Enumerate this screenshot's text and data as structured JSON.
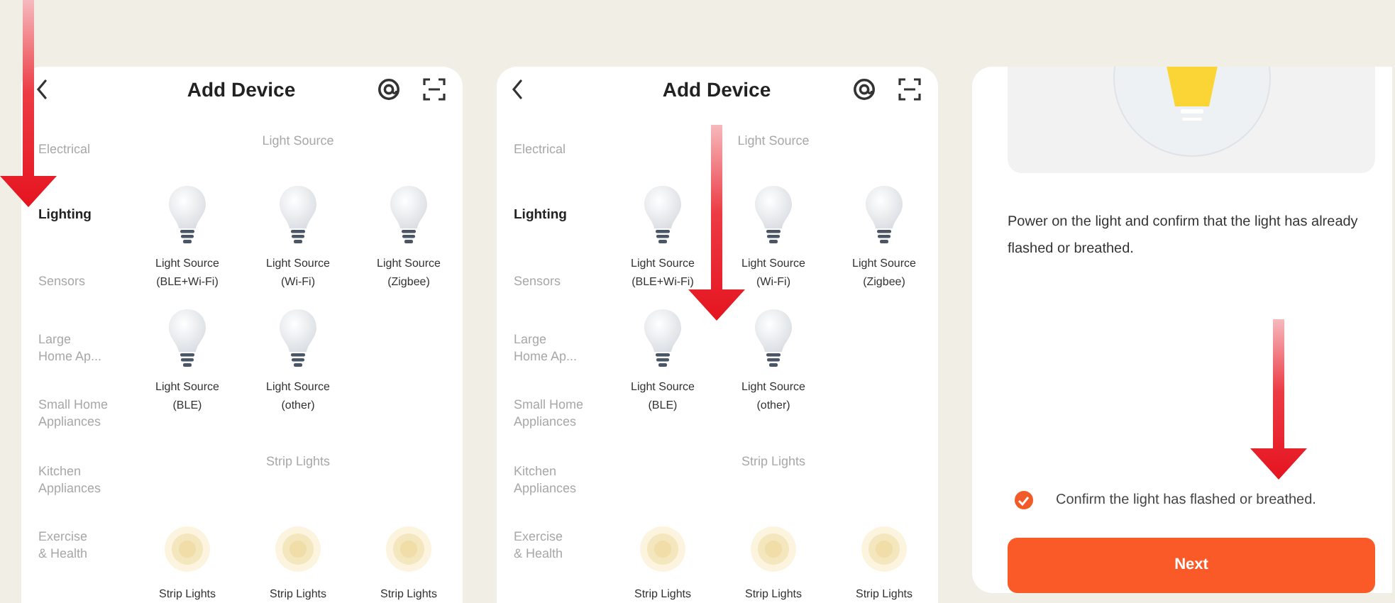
{
  "screens": [
    {
      "kind": "picker",
      "title": "Add Device",
      "categories": [
        {
          "label": "Electrical",
          "selected": false
        },
        {
          "label": "Lighting",
          "selected": true
        },
        {
          "label": "Sensors",
          "selected": false
        },
        {
          "label": "Large\nHome Ap...",
          "selected": false
        },
        {
          "label": "Small Home\nAppliances",
          "selected": false
        },
        {
          "label": "Kitchen\nAppliances",
          "selected": false
        },
        {
          "label": "Exercise\n& Health",
          "selected": false
        }
      ],
      "sections": [
        {
          "heading": "Light Source",
          "devices": [
            {
              "kind": "bulb",
              "name": "Light Source",
              "variant": "(BLE+Wi-Fi)"
            },
            {
              "kind": "bulb",
              "name": "Light Source",
              "variant": "(Wi-Fi)"
            },
            {
              "kind": "bulb",
              "name": "Light Source",
              "variant": "(Zigbee)"
            },
            {
              "kind": "bulb",
              "name": "Light Source",
              "variant": "(BLE)"
            },
            {
              "kind": "bulb",
              "name": "Light Source",
              "variant": "(other)"
            }
          ]
        },
        {
          "heading": "Strip Lights",
          "devices": [
            {
              "kind": "strip",
              "name": "Strip Lights"
            },
            {
              "kind": "strip",
              "name": "Strip Lights"
            },
            {
              "kind": "strip",
              "name": "Strip Lights"
            }
          ]
        }
      ]
    },
    {
      "kind": "picker",
      "title": "Add Device",
      "categories": [
        {
          "label": "Electrical",
          "selected": false
        },
        {
          "label": "Lighting",
          "selected": true
        },
        {
          "label": "Sensors",
          "selected": false
        },
        {
          "label": "Large\nHome Ap...",
          "selected": false
        },
        {
          "label": "Small Home\nAppliances",
          "selected": false
        },
        {
          "label": "Kitchen\nAppliances",
          "selected": false
        },
        {
          "label": "Exercise\n& Health",
          "selected": false
        }
      ],
      "sections": [
        {
          "heading": "Light Source",
          "devices": [
            {
              "kind": "bulb",
              "name": "Light Source",
              "variant": "(BLE+Wi-Fi)"
            },
            {
              "kind": "bulb",
              "name": "Light Source",
              "variant": "(Wi-Fi)"
            },
            {
              "kind": "bulb",
              "name": "Light Source",
              "variant": "(Zigbee)"
            },
            {
              "kind": "bulb",
              "name": "Light Source",
              "variant": "(BLE)"
            },
            {
              "kind": "bulb",
              "name": "Light Source",
              "variant": "(other)"
            }
          ]
        },
        {
          "heading": "Strip Lights",
          "devices": [
            {
              "kind": "strip",
              "name": "Strip Lights"
            },
            {
              "kind": "strip",
              "name": "Strip Lights"
            },
            {
              "kind": "strip",
              "name": "Strip Lights"
            }
          ]
        }
      ]
    },
    {
      "kind": "confirm",
      "instruction": "Power on the light and confirm that the light has already flashed or breathed.",
      "confirm": {
        "label": "Confirm the light has flashed or breathed.",
        "checked": true
      },
      "button": "Next"
    }
  ]
}
